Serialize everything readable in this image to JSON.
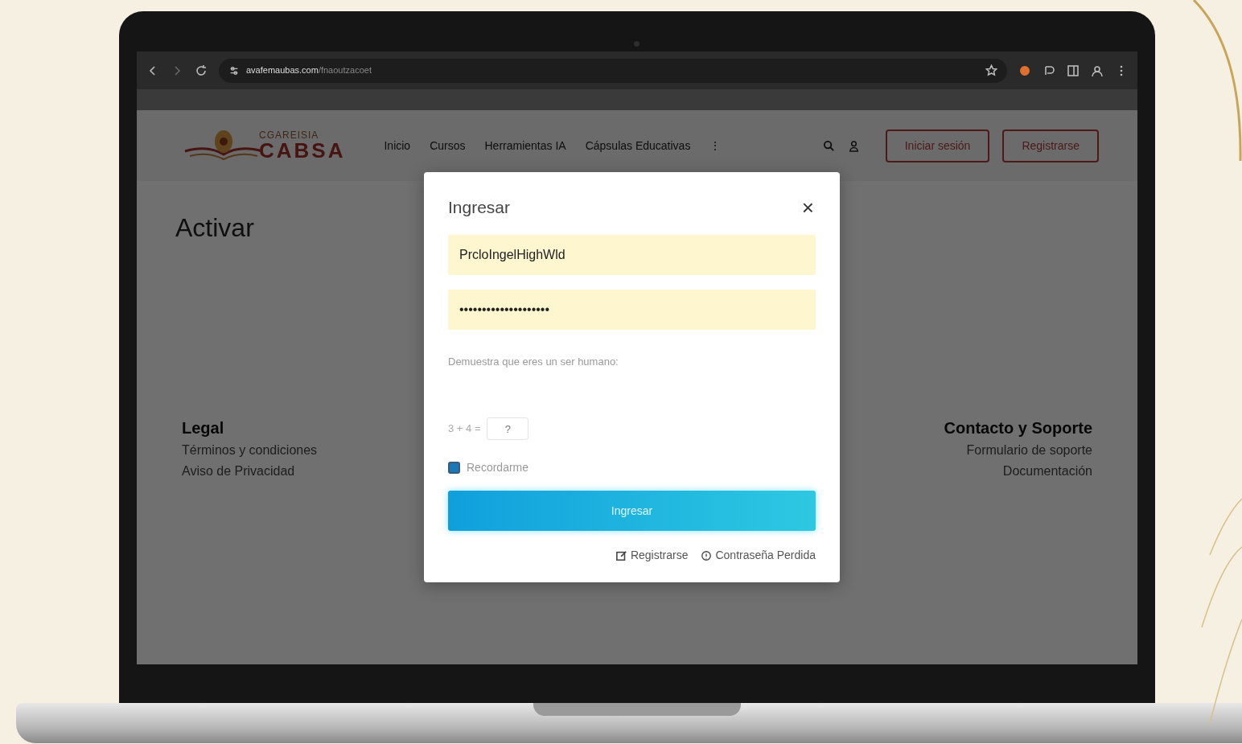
{
  "browser": {
    "url": "avafemaubas.com",
    "url_path": "/fnaoutzacoet"
  },
  "site": {
    "logo_top": "CGAREISIA",
    "logo_main": "CABSA",
    "nav": [
      {
        "label": "Inicio"
      },
      {
        "label": "Cursos"
      },
      {
        "label": "Herramientas IA"
      },
      {
        "label": "Cápsulas Educativas"
      },
      {
        "label": "⋮"
      }
    ],
    "header_buttons": [
      "Iniciar sesión",
      "Registrarse"
    ],
    "page_title": "Activar",
    "footer_left": {
      "heading": "Legal",
      "links": [
        "Términos y condiciones",
        "Aviso de Privacidad"
      ]
    },
    "footer_right": {
      "heading": "Contacto y Soporte",
      "links": [
        "Formulario de soporte",
        "Documentación"
      ]
    }
  },
  "modal": {
    "title": "Ingresar",
    "close": "×",
    "username": "PrcloIngelHighWld",
    "password": "••••••••••••••••••••",
    "captcha_label": "Demuestra que eres un ser humano:",
    "captcha_question": "3 + 4 =",
    "captcha_placeholder": "?",
    "remember": {
      "label": "Recordarme",
      "checked": true
    },
    "submit": "Ingresar",
    "links": [
      {
        "kind": "register",
        "label": "Registrarse"
      },
      {
        "kind": "lost",
        "label": "Contraseña Perdida"
      }
    ]
  }
}
